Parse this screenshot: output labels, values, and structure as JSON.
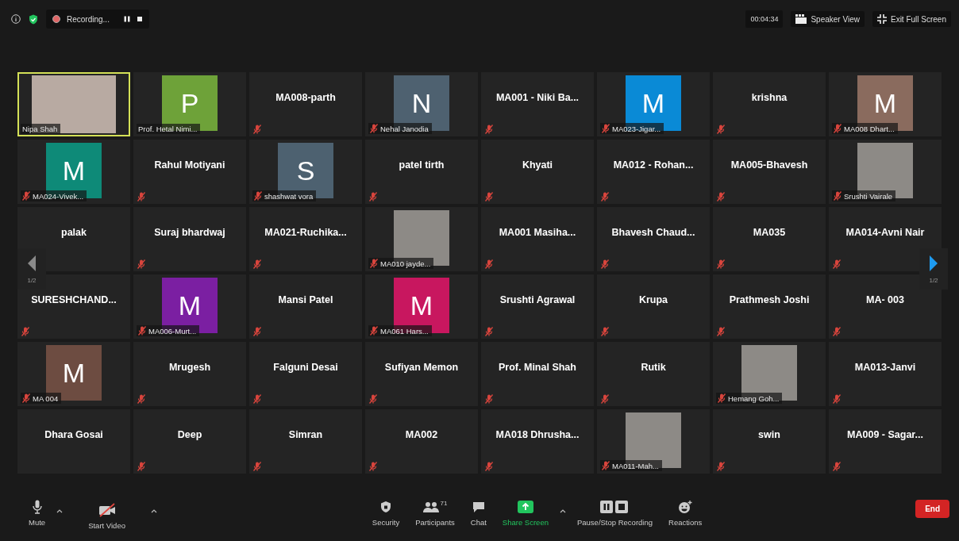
{
  "top_bar": {
    "recording": {
      "label": "Recording..."
    },
    "timer": "00:04:34",
    "buttons": [
      {
        "kind": "speaker",
        "label": "Speaker View"
      },
      {
        "kind": "exit",
        "label": "Exit Full Screen"
      }
    ]
  },
  "gallery": {
    "tiles": [
      {
        "kind": "video",
        "name": "Nipa Shah",
        "muted": false,
        "active_speaker": true
      },
      {
        "kind": "avatar",
        "initial": "P",
        "color": "#6ea239",
        "name": "Prof. Hetal Nimi...",
        "muted": false,
        "active_speaker": false
      },
      {
        "kind": "name",
        "name": "MA008-parth",
        "muted": true,
        "active_speaker": false
      },
      {
        "kind": "avatar",
        "initial": "N",
        "color": "#4e6170",
        "name": "Nehal Janodia",
        "muted": true,
        "active_speaker": false
      },
      {
        "kind": "name",
        "name": "MA001 - Niki Ba...",
        "muted": true,
        "active_speaker": false
      },
      {
        "kind": "avatar",
        "initial": "M",
        "color": "#0a8ad6",
        "name": "MA023-Jigar...",
        "muted": true,
        "active_speaker": false
      },
      {
        "kind": "name",
        "name": "krishna",
        "muted": true,
        "active_speaker": false
      },
      {
        "kind": "avatar",
        "initial": "M",
        "color": "#8a6b5e",
        "name": "MA008 Dhart...",
        "muted": true,
        "active_speaker": false
      },
      {
        "kind": "avatar",
        "initial": "M",
        "color": "#0e8a78",
        "name": "MA024-Vivek...",
        "muted": true,
        "active_speaker": false
      },
      {
        "kind": "name",
        "name": "Rahul Motiyani",
        "muted": true,
        "active_speaker": false
      },
      {
        "kind": "avatar",
        "initial": "S",
        "color": "#4d6170",
        "name": "shashwat vora",
        "muted": true,
        "active_speaker": false
      },
      {
        "kind": "name",
        "name": "patel tirth",
        "muted": true,
        "active_speaker": false
      },
      {
        "kind": "name",
        "name": "Khyati",
        "muted": true,
        "active_speaker": false
      },
      {
        "kind": "name",
        "name": "MA012 - Rohan...",
        "muted": true,
        "active_speaker": false
      },
      {
        "kind": "name",
        "name": "MA005-Bhavesh",
        "muted": true,
        "active_speaker": false
      },
      {
        "kind": "photo",
        "name": "Srushti Vairale",
        "muted": true,
        "active_speaker": false
      },
      {
        "kind": "name",
        "name": "palak",
        "muted": false,
        "active_speaker": false
      },
      {
        "kind": "name",
        "name": "Suraj bhardwaj",
        "muted": true,
        "active_speaker": false
      },
      {
        "kind": "name",
        "name": "MA021-Ruchika...",
        "muted": true,
        "active_speaker": false
      },
      {
        "kind": "photo",
        "name": "MA010 jayde...",
        "muted": true,
        "active_speaker": false
      },
      {
        "kind": "name",
        "name": "MA001 Masiha...",
        "muted": true,
        "active_speaker": false
      },
      {
        "kind": "name",
        "name": "Bhavesh Chaud...",
        "muted": true,
        "active_speaker": false
      },
      {
        "kind": "name",
        "name": "MA035",
        "muted": true,
        "active_speaker": false
      },
      {
        "kind": "name",
        "name": "MA014-Avni Nair",
        "muted": true,
        "active_speaker": false
      },
      {
        "kind": "name",
        "name": "SURESHCHAND...",
        "muted": true,
        "active_speaker": false
      },
      {
        "kind": "avatar",
        "initial": "M",
        "color": "#7b1fa2",
        "name": "MA006-Murt...",
        "muted": true,
        "active_speaker": false
      },
      {
        "kind": "name",
        "name": "Mansi Patel",
        "muted": true,
        "active_speaker": false
      },
      {
        "kind": "avatar",
        "initial": "M",
        "color": "#c8175f",
        "name": "MA061 Hars...",
        "muted": true,
        "active_speaker": false
      },
      {
        "kind": "name",
        "name": "Srushti Agrawal",
        "muted": true,
        "active_speaker": false
      },
      {
        "kind": "name",
        "name": "Krupa",
        "muted": true,
        "active_speaker": false
      },
      {
        "kind": "name",
        "name": "Prathmesh Joshi",
        "muted": true,
        "active_speaker": false
      },
      {
        "kind": "name",
        "name": "MA- 003",
        "muted": true,
        "active_speaker": false
      },
      {
        "kind": "avatar",
        "initial": "M",
        "color": "#6d4c41",
        "name": "MA 004",
        "muted": true,
        "active_speaker": false
      },
      {
        "kind": "name",
        "name": "Mrugesh",
        "muted": true,
        "active_speaker": false
      },
      {
        "kind": "name",
        "name": "Falguni Desai",
        "muted": true,
        "active_speaker": false
      },
      {
        "kind": "name",
        "name": "Sufiyan Memon",
        "muted": true,
        "active_speaker": false
      },
      {
        "kind": "name",
        "name": "Prof. Minal Shah",
        "muted": true,
        "active_speaker": false
      },
      {
        "kind": "name",
        "name": "Rutik",
        "muted": true,
        "active_speaker": false
      },
      {
        "kind": "photo",
        "name": "Hemang Goh...",
        "muted": true,
        "active_speaker": false
      },
      {
        "kind": "name",
        "name": "MA013-Janvi",
        "muted": true,
        "active_speaker": false
      },
      {
        "kind": "name",
        "name": "Dhara Gosai",
        "muted": false,
        "active_speaker": false
      },
      {
        "kind": "name",
        "name": "Deep",
        "muted": true,
        "active_speaker": false
      },
      {
        "kind": "name",
        "name": "Simran",
        "muted": true,
        "active_speaker": false
      },
      {
        "kind": "name",
        "name": "MA002",
        "muted": true,
        "active_speaker": false
      },
      {
        "kind": "name",
        "name": "MA018 Dhrusha...",
        "muted": true,
        "active_speaker": false
      },
      {
        "kind": "photo",
        "name": "MA011-Mah...",
        "muted": true,
        "active_speaker": false
      },
      {
        "kind": "name",
        "name": "swin",
        "muted": true,
        "active_speaker": false
      },
      {
        "kind": "name",
        "name": "MA009 - Sagar...",
        "muted": true,
        "active_speaker": false
      }
    ],
    "pager": {
      "previous": {
        "label": "1/2",
        "disabled": true
      },
      "next": {
        "label": "1/2",
        "disabled": false
      }
    }
  },
  "toolbar": {
    "controls": [
      {
        "kind": "mic",
        "label": "Mute"
      },
      {
        "kind": "caret"
      },
      {
        "kind": "video",
        "label": "Start Video"
      },
      {
        "kind": "caret"
      },
      {
        "kind": "spacer"
      },
      {
        "kind": "security",
        "label": "Security"
      },
      {
        "kind": "participants",
        "label": "Participants",
        "count": "71"
      },
      {
        "kind": "chat",
        "label": "Chat"
      },
      {
        "kind": "share",
        "label": "Share Screen"
      },
      {
        "kind": "caret"
      },
      {
        "kind": "record",
        "label": "Pause/Stop Recording"
      },
      {
        "kind": "reactions",
        "label": "Reactions"
      },
      {
        "kind": "spacer"
      },
      {
        "kind": "end",
        "label": "End"
      }
    ]
  }
}
